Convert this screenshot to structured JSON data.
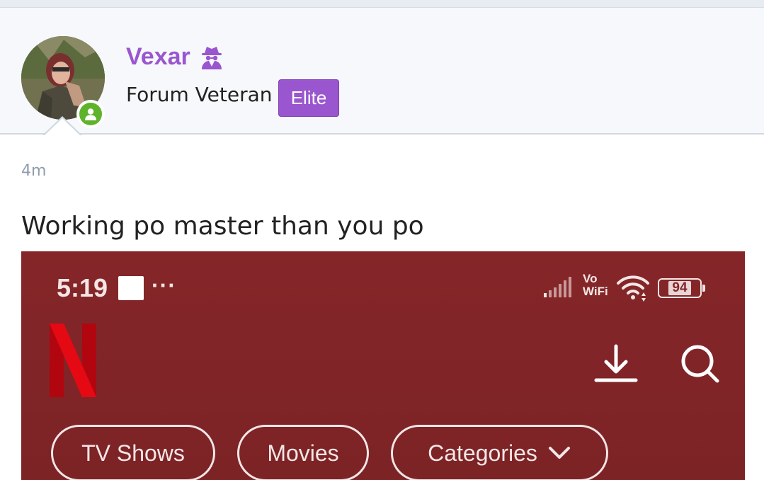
{
  "post": {
    "author": {
      "name": "Vexar",
      "title": "Forum Veteran",
      "badge": "Elite",
      "status": "online",
      "name_color": "#9a56cf",
      "name_icon": "user-secret-icon"
    },
    "time": "4m",
    "message": "Working po master than you po"
  },
  "screenshot": {
    "status_bar": {
      "time": "5:19",
      "dots": "···",
      "network_line1": "Vo",
      "network_line2": "WiFi",
      "battery": "94"
    },
    "app": {
      "logo": "N",
      "brand_color": "#e50914",
      "background_color": "#852629",
      "chips": [
        {
          "label": "TV Shows"
        },
        {
          "label": "Movies"
        },
        {
          "label": "Categories"
        }
      ]
    }
  }
}
